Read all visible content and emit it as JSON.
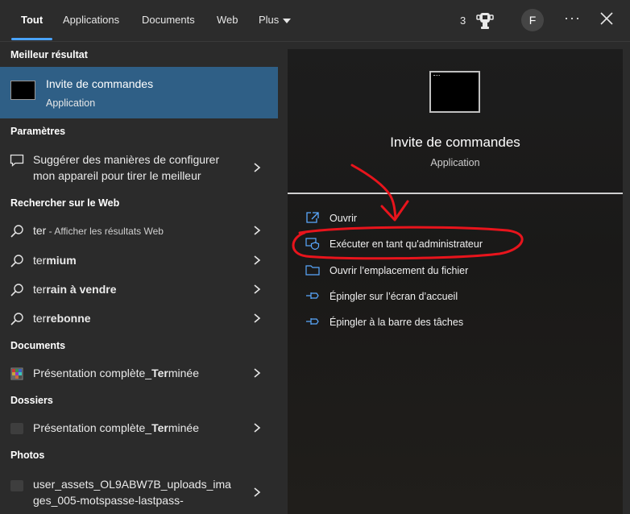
{
  "tabs": [
    {
      "label": "Tout",
      "active": true
    },
    {
      "label": "Applications"
    },
    {
      "label": "Documents"
    },
    {
      "label": "Web"
    },
    {
      "label": "Plus"
    }
  ],
  "header": {
    "points": "3",
    "avatar_letter": "F"
  },
  "sections": {
    "best": "Meilleur résultat",
    "settings": "Paramètres",
    "web": "Rechercher sur le Web",
    "documents": "Documents",
    "folders": "Dossiers",
    "photos": "Photos"
  },
  "best_match": {
    "title": "Invite de commandes",
    "subtitle": "Application"
  },
  "settings_item": {
    "line1": "Suggérer des manières de configurer",
    "line2": "mon appareil pour tirer le meilleur"
  },
  "web_items": [
    {
      "prefix": "ter",
      "suffix": " - Afficher les résultats Web"
    },
    {
      "prefix": "ter",
      "bold": "mium"
    },
    {
      "prefix": "ter",
      "bold": "rain à vendre"
    },
    {
      "prefix": "ter",
      "bold": "rebonne"
    }
  ],
  "document_item": {
    "before": "Présentation complète_",
    "match": "Ter",
    "after": "minée"
  },
  "folder_item": {
    "before": "Présentation complète_",
    "match": "Ter",
    "after": "minée"
  },
  "photo_item": {
    "line1": "user_assets_OL9ABW7B_uploads_ima",
    "line2": "ges_005-motspasse-lastpass-"
  },
  "preview": {
    "title": "Invite de commandes",
    "subtitle": "Application",
    "actions": [
      {
        "label": "Ouvrir",
        "icon": "open-icon"
      },
      {
        "label": "Exécuter en tant qu'administrateur",
        "icon": "shield-icon"
      },
      {
        "label": "Ouvrir l’emplacement du fichier",
        "icon": "folder-icon"
      },
      {
        "label": "Épingler sur l’écran d’accueil",
        "icon": "pin-icon"
      },
      {
        "label": "Épingler à la barre des tâches",
        "icon": "pin-icon"
      }
    ]
  },
  "colors": {
    "accent": "#4aa3ff",
    "selected": "#2f5f86",
    "annotation": "#e8141c"
  }
}
